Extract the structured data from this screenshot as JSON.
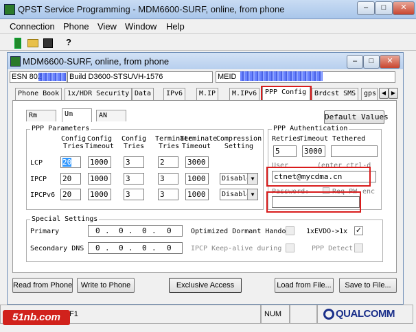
{
  "window": {
    "title": "QPST Service Programming - MDM6600-SURF, online, from phone",
    "controls": {
      "minimize": "–",
      "maximize": "□",
      "close": "✕"
    }
  },
  "menu": [
    "Connection",
    "Phone",
    "View",
    "Window",
    "Help"
  ],
  "toolbar": {
    "help": "?"
  },
  "child": {
    "title": "MDM6600-SURF, online, from phone",
    "esn_label": "ESN 802",
    "build": "Build D3600-STSUVH-1576",
    "meid_label": "MEID"
  },
  "tabs": [
    "Phone Book",
    "1x/HDR Security",
    "Data",
    "IPv6",
    "M.IP",
    "M.IPv6",
    "PPP Config",
    "Brdcst SMS",
    "gps"
  ],
  "subtabs": [
    "Rm",
    "Um",
    "AN"
  ],
  "default_values": "Default Values",
  "ppp_params": {
    "title": "PPP Parameters",
    "headers": {
      "config_tries": "Config Tries",
      "config_timeout": "Config Timeout",
      "config_tries2": "Config Tries",
      "terminate_tries": "Terminate Tries",
      "terminate_timeout": "Terminate Timeout",
      "compression": "Compression Setting"
    },
    "rows": [
      {
        "label": "LCP",
        "tries": "20",
        "timeout": "1000",
        "ctries": "3",
        "ttries": "2",
        "ttimeout": "3000",
        "comp": ""
      },
      {
        "label": "IPCP",
        "tries": "20",
        "timeout": "1000",
        "ctries": "3",
        "ttries": "3",
        "ttimeout": "1000",
        "comp": "Disable"
      },
      {
        "label": "IPCPv6",
        "tries": "20",
        "timeout": "1000",
        "ctries": "3",
        "ttries": "3",
        "ttimeout": "1000",
        "comp": "Disable"
      }
    ]
  },
  "ppp_auth": {
    "title": "PPP Authentication",
    "retries_label": "Retries",
    "timeout_label": "Timeout",
    "tethered_label": "Tethered",
    "retries": "5",
    "timeout": "3000",
    "user_label": "User",
    "user_hint": "(enter ctrl-d",
    "user": "ctnet@mycdma.cn",
    "password_label": "Password:",
    "req_pw_label": "Req PW",
    "enc_label": "enc",
    "password": ""
  },
  "special": {
    "title": "Special Settings",
    "primary_label": "Primary",
    "primary": [
      "0",
      "0",
      "0",
      "0"
    ],
    "secondary_label": "Secondary DNS",
    "secondary": [
      "0",
      "0",
      "0",
      "0"
    ],
    "optimized_label": "Optimized Dormant Handoff",
    "evdo_label": "1xEVDO->1x",
    "ipcp_keepalive_label": "IPCP Keep-alive during",
    "ppp_detect_label": "PPP Detect"
  },
  "buttons": {
    "read": "Read from Phone",
    "write": "Write to Phone",
    "exclusive": "Exclusive Access",
    "load": "Load from File...",
    "save": "Save to File..."
  },
  "statusbar": {
    "help": "F1",
    "num": "NUM",
    "logo": "QUALCOMM",
    "watermark": "51nb.com"
  },
  "colors": {
    "highlight": "#d81b1b",
    "selection": "#3399ff"
  }
}
